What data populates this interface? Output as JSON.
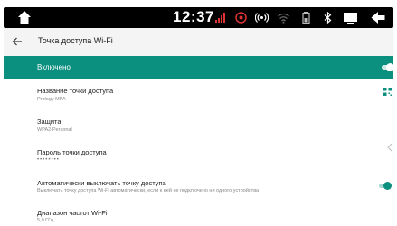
{
  "status_bar": {
    "time": "12:37",
    "icons": [
      "home-icon",
      "signal-icon",
      "location-icon",
      "hotspot-icon",
      "wifi-icon",
      "battery-icon",
      "bluetooth-icon",
      "screen-icon",
      "back-icon"
    ]
  },
  "app_bar": {
    "title": "Точка доступа Wi-Fi"
  },
  "master_toggle": {
    "label": "Включено",
    "state": "on"
  },
  "settings": [
    {
      "title": "Название точки доступа",
      "subtitle": "Prology MPA"
    },
    {
      "title": "Защита",
      "subtitle": "WPA2-Personal"
    },
    {
      "title": "Пароль точки доступа",
      "subtitle": "••••••••"
    },
    {
      "title": "Автоматически выключать точку доступа",
      "subtitle": "Выключать точку доступа Wi-Fi автоматически, если к ней не подключено ни одного устройства",
      "toggle": "on"
    },
    {
      "title": "Диапазон частот Wi-Fi",
      "subtitle": "5,0 ГГц"
    }
  ],
  "colors": {
    "accent": "#0b8f7f",
    "toggle_on_knob": "#0b8f7f",
    "status_bar": "#000000"
  }
}
